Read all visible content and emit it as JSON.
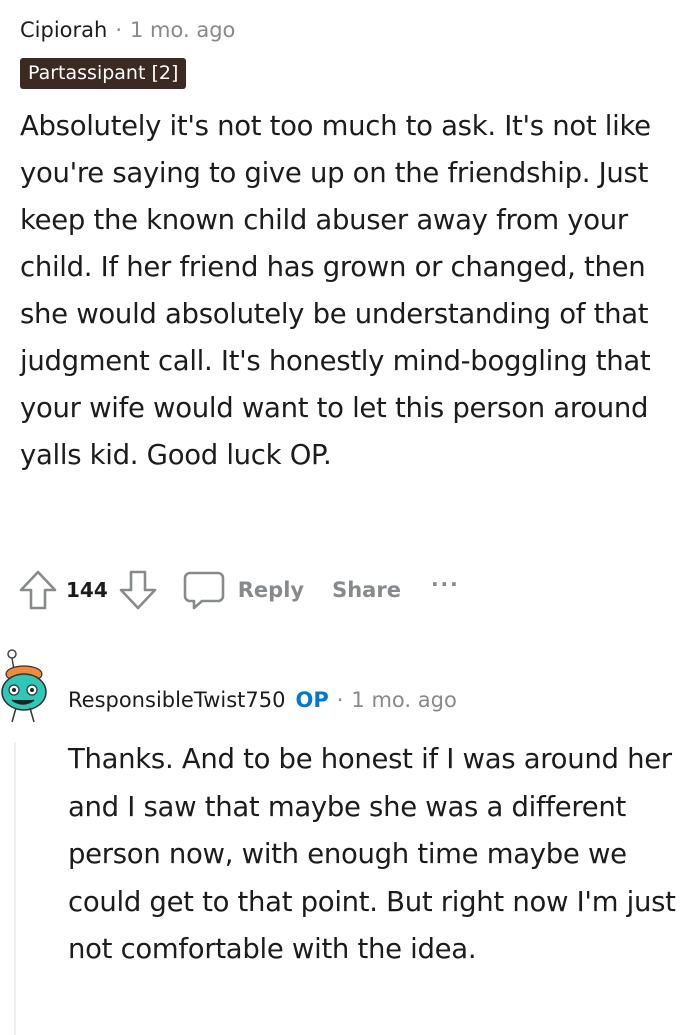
{
  "comment1": {
    "author": "Cipiorah",
    "separator": "·",
    "time": "1 mo. ago",
    "flair": "Partassipant [2]",
    "body": "Absolutely it's not too much to ask. It's not like you're saying to give up on the friendship. Just keep the known child abuser away from your child. If her friend has grown or changed, then she would absolutely be understanding of that judgment call. It's honestly mind-boggling that your wife would want to let this person around yalls kid. Good luck OP.",
    "score": "144",
    "actions": {
      "reply": "Reply",
      "share": "Share",
      "more": "···"
    }
  },
  "comment2": {
    "author": "ResponsibleTwist750",
    "op_badge": "OP",
    "separator": "·",
    "time": "1 mo. ago",
    "body": "Thanks. And to be honest if I was around her and I saw that maybe she was a different person now, with enough time maybe we could get to that point. But right now I'm just not comfortable with the idea."
  },
  "icons": {
    "upvote": "upvote-arrow-icon",
    "downvote": "downvote-arrow-icon",
    "reply": "speech-bubble-icon",
    "avatar": "snoo-avatar-icon"
  },
  "colors": {
    "muted": "#878a8c",
    "flair_bg": "#3a2a22",
    "op_blue": "#0079d3",
    "avatar_teal": "#2fc7b8",
    "avatar_orange": "#f08a3c"
  }
}
